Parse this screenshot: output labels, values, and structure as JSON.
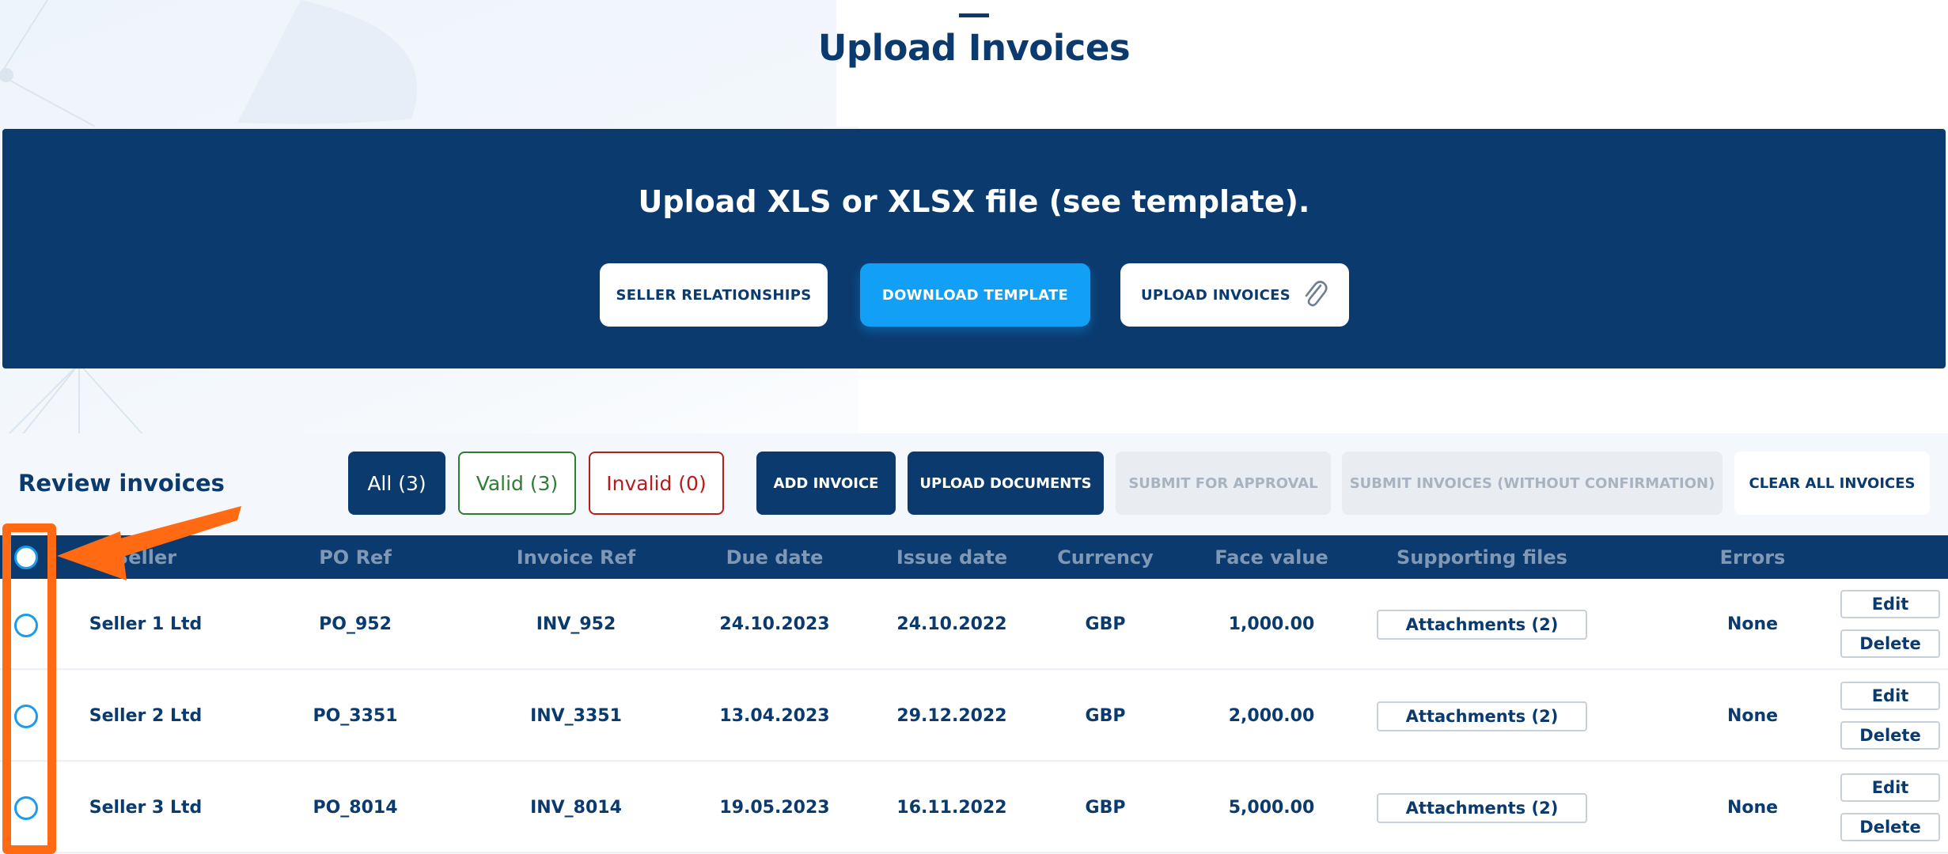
{
  "page": {
    "title": "Upload Invoices"
  },
  "banner": {
    "text": "Upload XLS or XLSX file (see template).",
    "buttons": {
      "seller_relationships": "SELLER RELATIONSHIPS",
      "download_template": "DOWNLOAD TEMPLATE",
      "upload_invoices": "UPLOAD INVOICES"
    },
    "upload_icon": "paperclip-icon"
  },
  "review": {
    "title": "Review invoices",
    "filters": {
      "all": "All (3)",
      "valid": "Valid (3)",
      "invalid": "Invalid (0)"
    },
    "actions": {
      "add_invoice": "ADD INVOICE",
      "upload_documents": "UPLOAD DOCUMENTS",
      "submit_for_approval": "SUBMIT FOR APPROVAL",
      "submit_without_confirmation": "SUBMIT INVOICES (WITHOUT CONFIRMATION)",
      "clear_all": "CLEAR ALL INVOICES"
    }
  },
  "table": {
    "headers": {
      "seller": "Seller",
      "po_ref": "PO Ref",
      "invoice_ref": "Invoice Ref",
      "due_date": "Due date",
      "issue_date": "Issue date",
      "currency": "Currency",
      "face_value": "Face value",
      "supporting_files": "Supporting files",
      "errors": "Errors"
    },
    "rows": [
      {
        "seller": "Seller 1 Ltd",
        "po_ref": "PO_952",
        "invoice_ref": "INV_952",
        "due_date": "24.10.2023",
        "issue_date": "24.10.2022",
        "currency": "GBP",
        "face_value": "1,000.00",
        "attachments": "Attachments (2)",
        "errors": "None",
        "edit": "Edit",
        "delete": "Delete"
      },
      {
        "seller": "Seller 2 Ltd",
        "po_ref": "PO_3351",
        "invoice_ref": "INV_3351",
        "due_date": "13.04.2023",
        "issue_date": "29.12.2022",
        "currency": "GBP",
        "face_value": "2,000.00",
        "attachments": "Attachments (2)",
        "errors": "None",
        "edit": "Edit",
        "delete": "Delete"
      },
      {
        "seller": "Seller 3 Ltd",
        "po_ref": "PO_8014",
        "invoice_ref": "INV_8014",
        "due_date": "19.05.2023",
        "issue_date": "16.11.2022",
        "currency": "GBP",
        "face_value": "5,000.00",
        "attachments": "Attachments (2)",
        "errors": "None",
        "edit": "Edit",
        "delete": "Delete"
      }
    ]
  },
  "colors": {
    "navy": "#0b3a6e",
    "accent_blue": "#12a0f7",
    "valid_green": "#2e7d32",
    "invalid_red": "#b71c1c",
    "annotation_orange": "#ff6a13"
  }
}
